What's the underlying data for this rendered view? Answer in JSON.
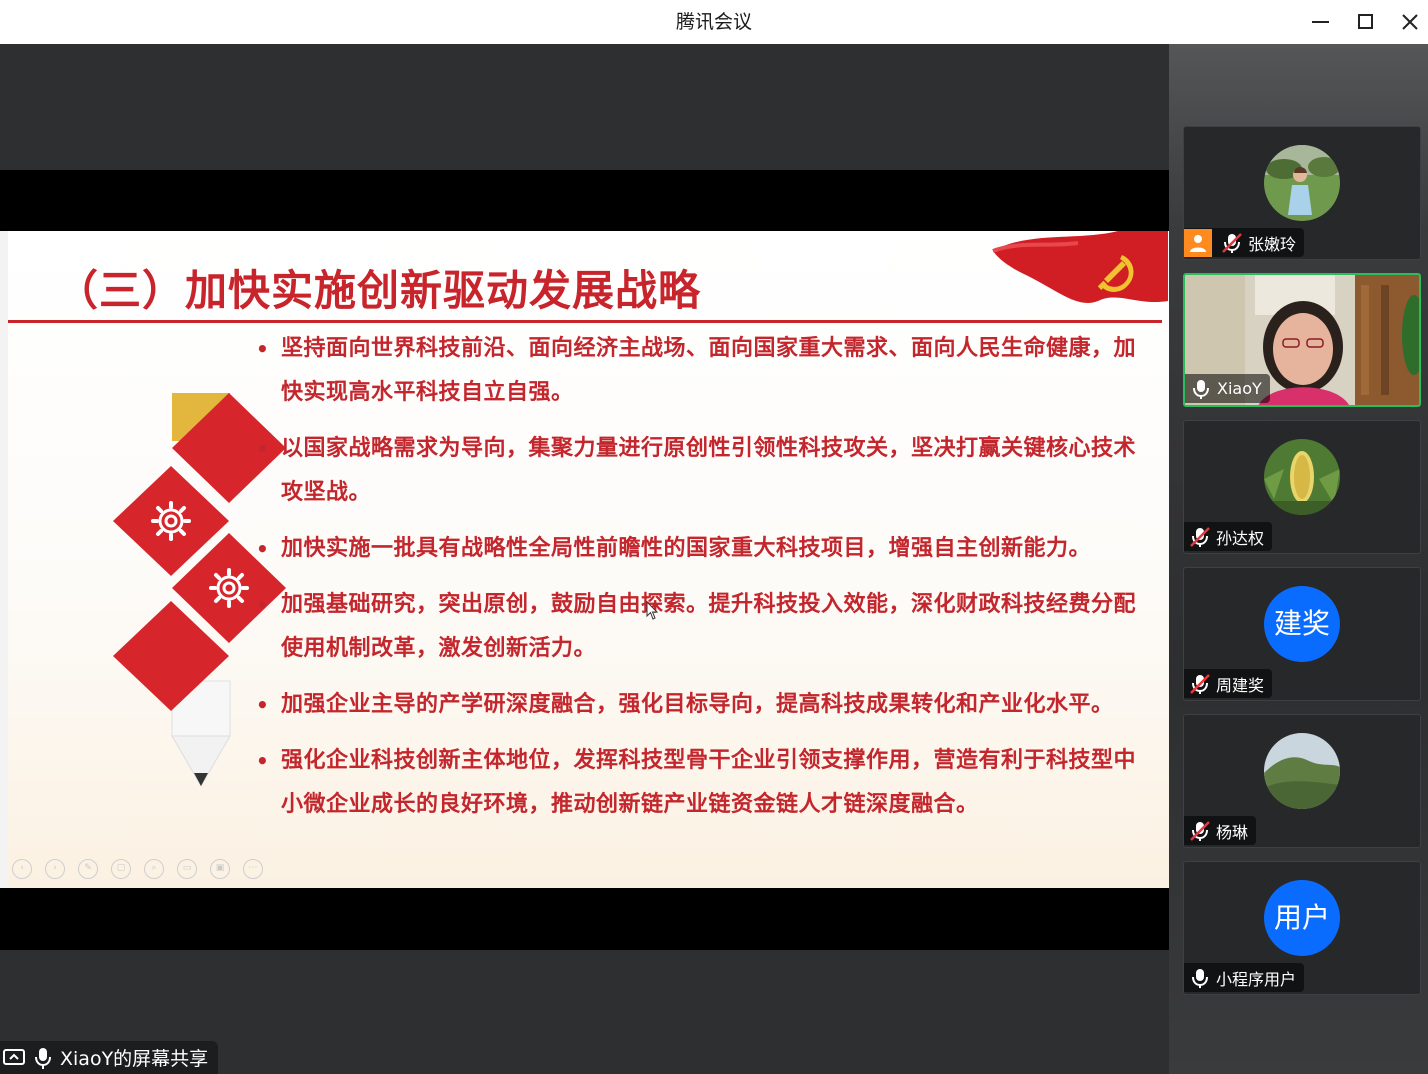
{
  "window": {
    "title": "腾讯会议"
  },
  "slide": {
    "title": "（三）加快实施创新驱动发展战略",
    "bullets": [
      "坚持面向世界科技前沿、面向经济主战场、面向国家重大需求、面向人民生命健康，加快实现高水平科技自立自强。",
      "以国家战略需求为导向，集聚力量进行原创性引领性科技攻关，坚决打赢关键核心技术攻坚战。",
      "加快实施一批具有战略性全局性前瞻性的国家重大科技项目，增强自主创新能力。",
      "加强基础研究，突出原创，鼓励自由探索。提升科技投入效能，深化财政科技经费分配使用机制改革，激发创新活力。",
      "加强企业主导的产学研深度融合，强化目标导向，提高科技成果转化和产业化水平。",
      "强化企业科技创新主体地位，发挥科技型骨干企业引领支撑作用，营造有利于科技型中小微企业成长的良好环境，推动创新链产业链资金链人才链深度融合。"
    ]
  },
  "share": {
    "label": "XiaoY的屏幕共享"
  },
  "participants": [
    {
      "name": "张嫩玲",
      "muted": true,
      "host": true,
      "avatar_kind": "photo-child"
    },
    {
      "name": "XiaoY",
      "muted": false,
      "host": false,
      "avatar_kind": "video",
      "active": true
    },
    {
      "name": "孙达权",
      "muted": true,
      "host": false,
      "avatar_kind": "photo-plant"
    },
    {
      "name": "周建奖",
      "muted": true,
      "host": false,
      "avatar_kind": "text",
      "avatar_text": "建奖"
    },
    {
      "name": "杨琳",
      "muted": true,
      "host": false,
      "avatar_kind": "photo-mountain"
    },
    {
      "name": "小程序用户",
      "muted": false,
      "host": false,
      "avatar_kind": "text",
      "avatar_text": "用户"
    }
  ],
  "colors": {
    "accent_red": "#c8242b",
    "active_border": "#2bbd5c",
    "avatar_blue": "#0a6cff",
    "host_orange": "#ff8a1f"
  }
}
